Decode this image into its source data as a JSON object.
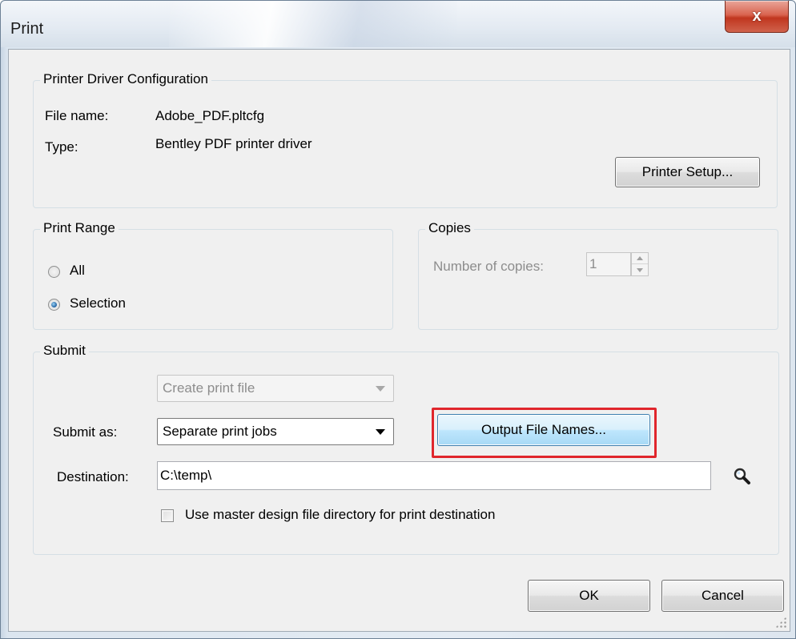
{
  "window": {
    "title": "Print",
    "close_glyph": "x",
    "accent_color": "#c0361f"
  },
  "driver_config": {
    "group_label": "Printer Driver Configuration",
    "file_name_label": "File name:",
    "file_name_value": "Adobe_PDF.pltcfg",
    "type_label": "Type:",
    "type_value": "Bentley PDF printer driver",
    "printer_setup_label": "Printer Setup..."
  },
  "print_range": {
    "group_label": "Print Range",
    "options": [
      {
        "label": "All",
        "selected": false
      },
      {
        "label": "Selection",
        "selected": true
      }
    ]
  },
  "copies": {
    "group_label": "Copies",
    "number_label": "Number of copies:",
    "number_value": "1"
  },
  "submit": {
    "group_label": "Submit",
    "mode_combo_value": "Create print file",
    "submit_as_label": "Submit as:",
    "submit_as_value": "Separate print jobs",
    "output_file_names_label": "Output File Names...",
    "destination_label": "Destination:",
    "destination_value": "C:\\temp\\",
    "browse_icon": "magnifier-icon",
    "use_master_label": "Use master design file directory for print destination",
    "use_master_checked": false,
    "highlight_color": "#e0262c"
  },
  "footer": {
    "ok_label": "OK",
    "cancel_label": "Cancel"
  }
}
